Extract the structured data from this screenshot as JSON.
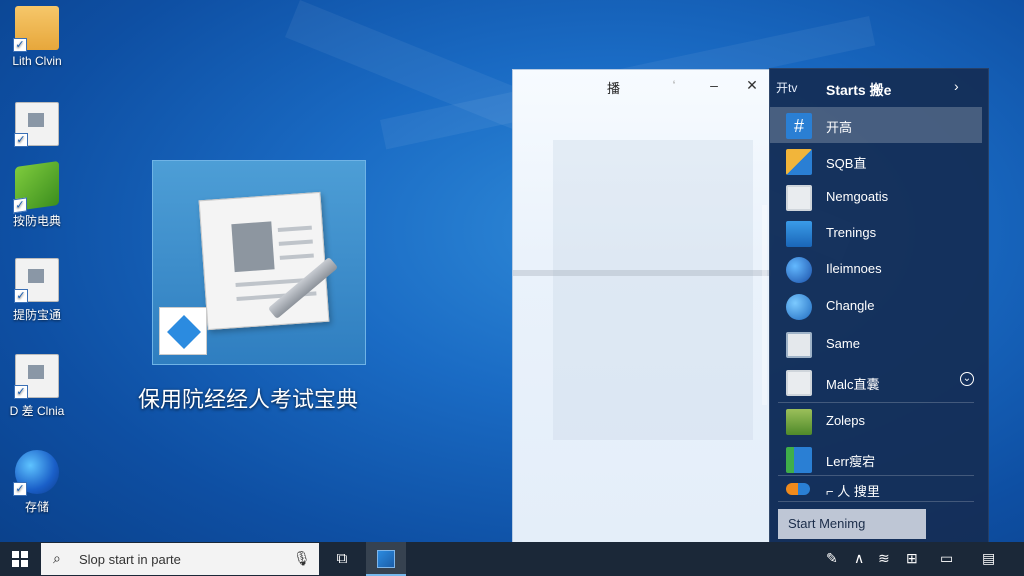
{
  "desktop": {
    "icons": [
      {
        "label": "Lith Clvin",
        "icon": "folder-icon"
      },
      {
        "label": "",
        "icon": "document-icon"
      },
      {
        "label": "按防电典",
        "icon": "green-app-icon"
      },
      {
        "label": "提防宝通",
        "icon": "document-icon"
      },
      {
        "label": "D 差 Clnia",
        "icon": "document-icon"
      },
      {
        "label": "存储",
        "icon": "globe-icon"
      }
    ],
    "featured_app": {
      "label": "保用阬经经人考试宝典",
      "icon": "exam-app-icon"
    }
  },
  "window": {
    "title": "播",
    "minimize": "–",
    "maximize": "□",
    "close": "✕"
  },
  "start_panel": {
    "tag": "开tv",
    "title": "Starts 搬e",
    "chevron": "›",
    "items": [
      {
        "label": "开高",
        "icon": "hash-icon",
        "active": true
      },
      {
        "label": "SQB直",
        "icon": "windows-folder-icon"
      },
      {
        "label": "Nemgoatis",
        "icon": "portrait-icon"
      },
      {
        "label": "Trenings",
        "icon": "folder-icon"
      },
      {
        "label": "Ileimnoes",
        "icon": "globe-icon"
      },
      {
        "label": "Changle",
        "icon": "globe-icon"
      },
      {
        "label": "Same",
        "icon": "document-icon"
      },
      {
        "label": "Malc直囊",
        "icon": "portrait-icon",
        "aux": "⌄"
      },
      {
        "label": "Zoleps",
        "icon": "folder-icon"
      },
      {
        "label": "Lerr瘦宕",
        "icon": "chart-icon"
      },
      {
        "label": "⌐ 人 搜里",
        "icon": "toggle-icon"
      }
    ],
    "start_button": "Start Menimg"
  },
  "taskbar": {
    "search_placeholder": "Slop start in parte",
    "tray_icons": [
      "pen-icon",
      "chevron-up-icon",
      "network-icon",
      "display-icon",
      "notification-icon"
    ]
  }
}
